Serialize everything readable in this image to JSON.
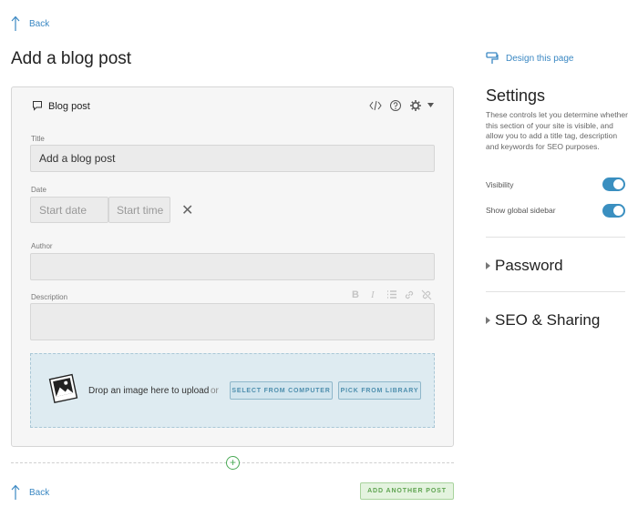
{
  "top_back": {
    "label": "Back"
  },
  "page_title": "Add a blog post",
  "card": {
    "title": "Blog post",
    "title_field": {
      "label": "Title",
      "value": "Add a blog post"
    },
    "date_field": {
      "label": "Date",
      "start_date_placeholder": "Start date",
      "start_time_placeholder": "Start time"
    },
    "author_field": {
      "label": "Author",
      "value": ""
    },
    "description_field": {
      "label": "Description",
      "value": ""
    },
    "upload": {
      "drop_text": "Drop an image here to upload",
      "or_text": "or",
      "select_button": "SELECT FROM COMPUTER",
      "library_button": "PICK FROM LIBRARY"
    }
  },
  "add_another_post": "ADD ANOTHER POST",
  "bottom_back": {
    "label": "Back"
  },
  "sidebar": {
    "design_link": "Design this page",
    "settings_title": "Settings",
    "settings_desc": "These controls let you determine whether this section of your site is visible, and allow you to add a title tag, description and keywords for SEO purposes.",
    "toggles": [
      {
        "label": "Visibility",
        "on": true
      },
      {
        "label": "Show global sidebar",
        "on": true
      }
    ],
    "sections": [
      {
        "label": "Password"
      },
      {
        "label": "SEO & Sharing"
      }
    ]
  },
  "colors": {
    "accent": "#3a8fc0",
    "green": "#4aaa55",
    "link": "#3b88c3"
  }
}
